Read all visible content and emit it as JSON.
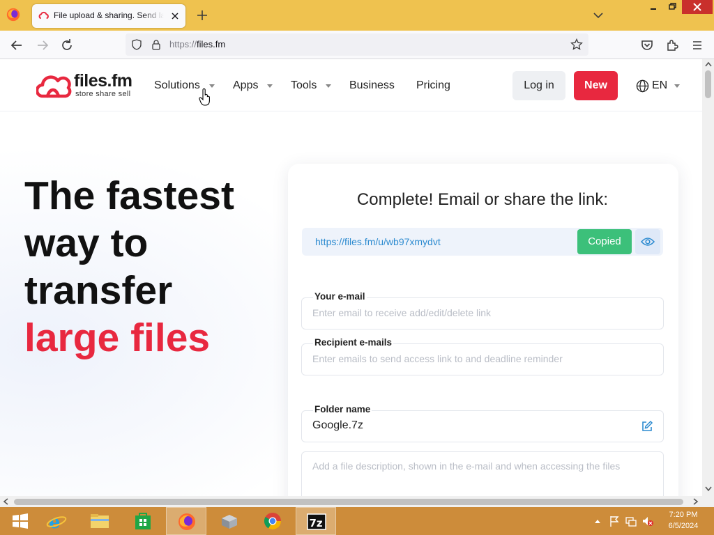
{
  "browser": {
    "tab_title": "File upload & sharing. Send large files",
    "url_scheme": "https://",
    "url_host": "files.fm"
  },
  "site": {
    "logo_name": "files.fm",
    "logo_tagline": "store  share  sell",
    "menu": {
      "solutions": "Solutions",
      "apps": "Apps",
      "tools": "Tools",
      "business": "Business",
      "pricing": "Pricing"
    },
    "login_label": "Log in",
    "new_label": "New",
    "language": "EN"
  },
  "hero": {
    "line1": "The fastest",
    "line2": "way to",
    "line3": "transfer",
    "line4": "large files"
  },
  "share_card": {
    "title": "Complete! Email or share the link:",
    "link": "https://files.fm/u/wb97xmydvt",
    "copied_label": "Copied",
    "email_label": "Your e-mail",
    "email_placeholder": "Enter email to receive add/edit/delete link",
    "recipients_label": "Recipient e-mails",
    "recipients_placeholder": "Enter emails to send access link to and deadline reminder",
    "folder_label": "Folder name",
    "folder_value": "Google.7z",
    "description_placeholder": "Add a file description, shown in the e-mail and when accessing the files"
  },
  "taskbar": {
    "clock_time": "7:20 PM",
    "clock_date": "6/5/2024"
  },
  "colors": {
    "brand_red": "#e8283f",
    "copied_green": "#3cc07a",
    "link_blue": "#2d8bd0",
    "tabbar": "#efc24f",
    "taskbar": "#cd8c3a"
  }
}
